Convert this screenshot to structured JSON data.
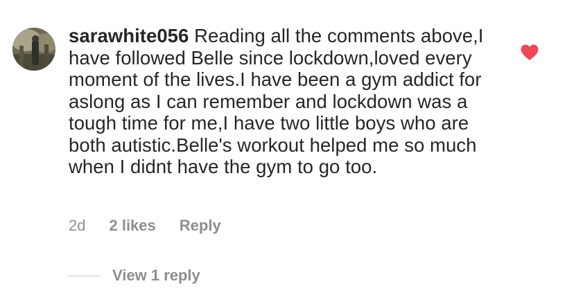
{
  "comment": {
    "username": "sarawhite056",
    "text": "Reading all the comments above,I have followed Belle since lockdown,loved every moment of the lives.I have been a gym addict for aslong as I can remember and lockdown was a tough time for me,I have two little boys who are both autistic.Belle's workout helped me so much when I didnt have the gym to go too.",
    "liked": true,
    "like_icon": "heart-icon",
    "like_color": "#ed4956",
    "meta": {
      "time": "2d",
      "likes": "2 likes",
      "reply_label": "Reply"
    },
    "view_replies_label": "View 1 reply"
  }
}
